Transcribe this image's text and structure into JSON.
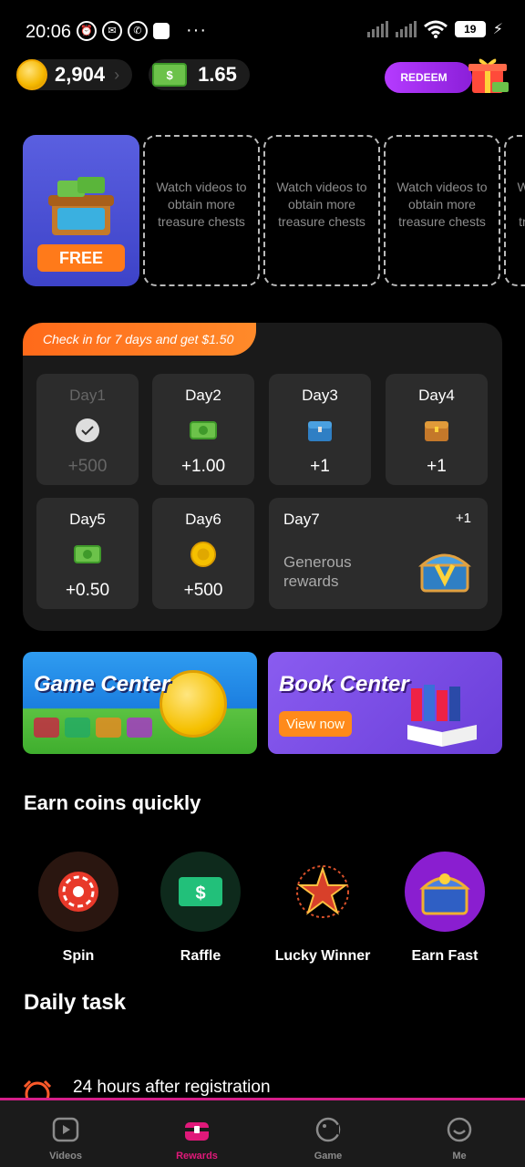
{
  "status_bar": {
    "time": "20:06",
    "battery": "19",
    "more": "···"
  },
  "balance": {
    "coins": "2,904",
    "cash": "1.65",
    "cash_symbol": "$"
  },
  "header": {
    "redeem_label": "REDEEM"
  },
  "chests": {
    "free_label": "FREE",
    "slot_text": "Watch videos to obtain more treasure chests",
    "slots": [
      "Watch videos to obtain more treasure chests",
      "Watch videos to obtain more treasure chests",
      "Watch videos to obtain more treasure chests",
      "Watch videos to obtain more treasure chests"
    ]
  },
  "checkin": {
    "banner": "Check in for 7 days and get $1.50",
    "days": [
      {
        "label": "Day1",
        "value": "+500",
        "icon": "check-icon",
        "done": true
      },
      {
        "label": "Day2",
        "value": "+1.00",
        "icon": "cash-icon",
        "done": false
      },
      {
        "label": "Day3",
        "value": "+1",
        "icon": "blue-chest-icon",
        "done": false
      },
      {
        "label": "Day4",
        "value": "+1",
        "icon": "gold-chest-icon",
        "done": false
      },
      {
        "label": "Day5",
        "value": "+0.50",
        "icon": "cash-icon",
        "done": false
      },
      {
        "label": "Day6",
        "value": "+500",
        "icon": "coin-icon",
        "done": false
      }
    ],
    "day7": {
      "label": "Day7",
      "value": "+1",
      "desc": "Generous rewards",
      "icon": "treasure-chest-icon"
    }
  },
  "centers": {
    "game_center": "Game Center",
    "book_center": "Book Center",
    "view_now": "View now"
  },
  "earn": {
    "title": "Earn coins quickly",
    "items": [
      {
        "label": "Spin",
        "icon": "spin-wheel-icon"
      },
      {
        "label": "Raffle",
        "icon": "raffle-ticket-icon"
      },
      {
        "label": "Lucky Winner",
        "icon": "lucky-star-icon"
      },
      {
        "label": "Earn Fast",
        "icon": "treasure-chest-icon"
      }
    ]
  },
  "daily": {
    "title": "Daily task",
    "task": "24 hours after registration"
  },
  "nav": {
    "items": [
      {
        "label": "Videos",
        "icon": "play-icon"
      },
      {
        "label": "Rewards",
        "icon": "rewards-icon"
      },
      {
        "label": "Game",
        "icon": "game-icon"
      },
      {
        "label": "Me",
        "icon": "smile-icon"
      }
    ]
  },
  "colors": {
    "accent": "#e0197a",
    "banner_orange": "#ff7a1a",
    "redeem_purple": "#9b2fe6",
    "panel_bg": "#1a1a1a"
  }
}
